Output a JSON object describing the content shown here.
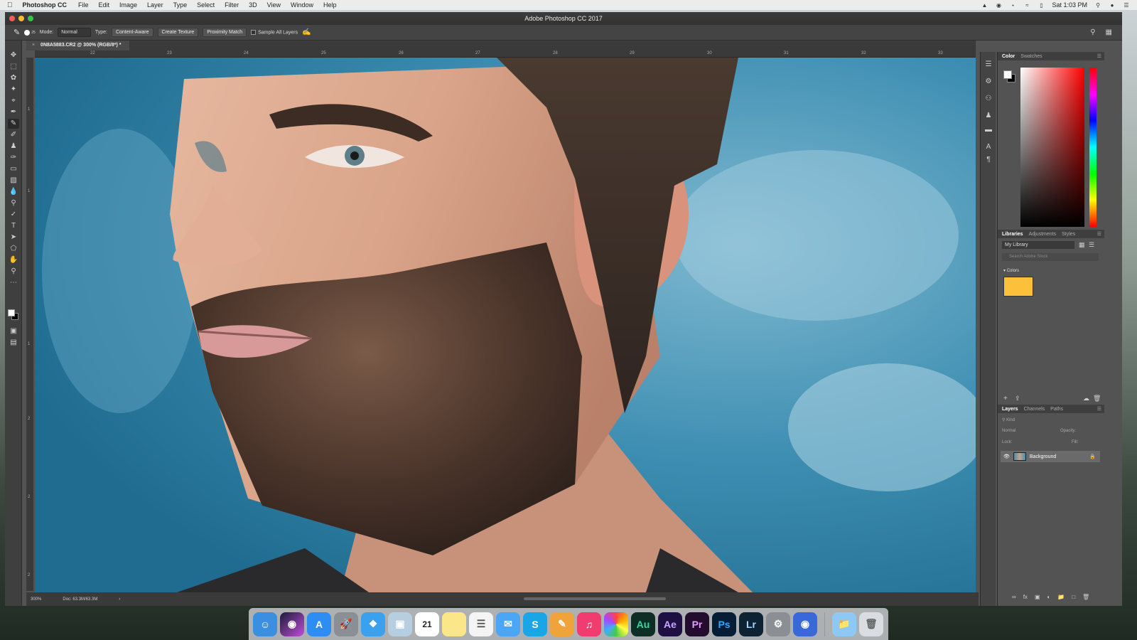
{
  "menubar": {
    "app_name": "Photoshop CC",
    "items": [
      "File",
      "Edit",
      "Image",
      "Layer",
      "Type",
      "Select",
      "Filter",
      "3D",
      "View",
      "Window",
      "Help"
    ],
    "clock": "Sat 1:03 PM"
  },
  "window": {
    "title": "Adobe Photoshop CC 2017"
  },
  "options_bar": {
    "brush_size": "25",
    "mode_label": "Mode:",
    "mode_value": "Normal",
    "type_label": "Type:",
    "type_options": [
      "Content-Aware",
      "Create Texture",
      "Proximity Match"
    ],
    "sample_all_layers": "Sample All Layers"
  },
  "document": {
    "tab_title": "0N8A5883.CR2 @ 300% (RGB/8*) *",
    "ruler_top": [
      "22",
      "23",
      "24",
      "25",
      "26",
      "27",
      "28",
      "29",
      "30",
      "31",
      "32",
      "33"
    ],
    "ruler_left": [
      "1",
      "1",
      "1",
      "2",
      "2",
      "2"
    ],
    "zoom": "300%",
    "doc_size": "Doc: 63.3M/63.3M"
  },
  "color_panel": {
    "tabs": [
      "Color",
      "Swatches"
    ],
    "foreground": "#ffffff",
    "background": "#000000"
  },
  "libraries_panel": {
    "tabs": [
      "Libraries",
      "Adjustments",
      "Styles"
    ],
    "library_name": "My Library",
    "search_placeholder": "Search Adobe Stock",
    "group_label": "Colors",
    "swatch_color": "#fcc03a"
  },
  "layers_panel": {
    "tabs": [
      "Layers",
      "Channels",
      "Paths"
    ],
    "kind_label": "Kind",
    "blend_mode": "Normal",
    "opacity_label": "Opacity:",
    "lock_label": "Lock:",
    "fill_label": "Fill:",
    "layer_name": "Background"
  },
  "dock": {
    "apps": [
      "Finder",
      "Siri",
      "App Store",
      "Launchpad",
      "Safari",
      "Preview",
      "Calendar",
      "Notes",
      "Reminders",
      "Messages",
      "Skype",
      "Pages",
      "iTunes",
      "Photos",
      "Au",
      "Ae",
      "Pr",
      "Ps",
      "Lr",
      "System Preferences",
      "Image Capture",
      "Folder",
      "Trash"
    ],
    "calendar_day": "21"
  },
  "colors": {
    "ps_bg": "#535353",
    "photo_sky": "#3f8fb1",
    "swatch_yellow": "#fcc03a"
  }
}
